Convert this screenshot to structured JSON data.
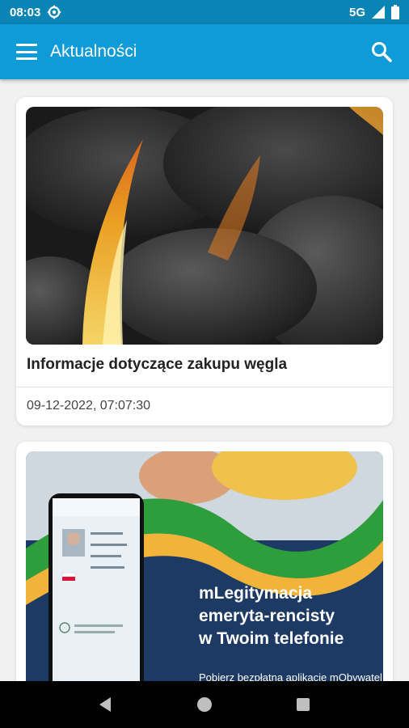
{
  "status_bar": {
    "time": "08:03",
    "network": "5G"
  },
  "app_bar": {
    "title": "Aktualności"
  },
  "news": [
    {
      "title": "Informacje dotyczące zakupu węgla",
      "date": "09-12-2022, 07:07:30"
    },
    {
      "banner": {
        "heading_line1": "mLegitymacja",
        "heading_line2": "emeryta-rencisty",
        "heading_line3": "w Twoim telefonie",
        "subtext": "Pobierz bezpłatną aplikację mObywatel"
      }
    }
  ],
  "colors": {
    "status_bar": "#0a83b5",
    "app_bar": "#0e9bd7",
    "banner_navy": "#1c3a63",
    "banner_green": "#2e9e3d",
    "banner_yellow": "#f2b33a"
  }
}
